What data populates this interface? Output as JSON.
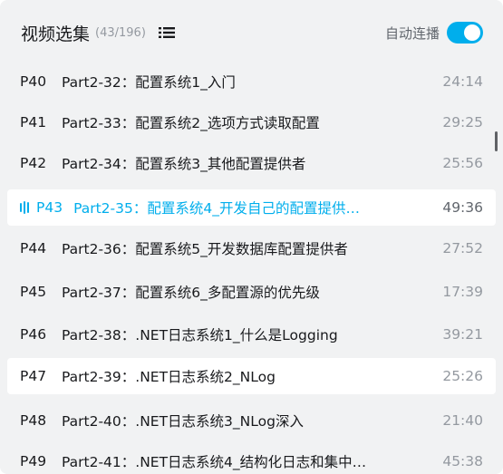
{
  "header": {
    "title": "视频选集",
    "count": "(43/196)",
    "list_icon": "list-icon",
    "autoplay_label": "自动连播",
    "autoplay_on": true
  },
  "episodes": [
    {
      "ep": "P40",
      "title": "Part2-32：配置系统1_入门",
      "duration": "24:14"
    },
    {
      "ep": "P41",
      "title": "Part2-33：配置系统2_选项方式读取配置",
      "duration": "29:25"
    },
    {
      "ep": "P42",
      "title": "Part2-34：配置系统3_其他配置提供者",
      "duration": "25:56"
    },
    {
      "ep": "P43",
      "title": "Part2-35：配置系统4_开发自己的配置提供…",
      "duration": "49:36"
    },
    {
      "ep": "P44",
      "title": "Part2-36：配置系统5_开发数据库配置提供者",
      "duration": "27:52"
    },
    {
      "ep": "P45",
      "title": "Part2-37：配置系统6_多配置源的优先级",
      "duration": "17:39"
    },
    {
      "ep": "P46",
      "title": "Part2-38：.NET日志系统1_什么是Logging",
      "duration": "39:21"
    },
    {
      "ep": "P47",
      "title": "Part2-39：.NET日志系统2_NLog",
      "duration": "25:26"
    },
    {
      "ep": "P48",
      "title": "Part2-40：.NET日志系统3_NLog深入",
      "duration": "21:40"
    },
    {
      "ep": "P49",
      "title": "Part2-41：.NET日志系统4_结构化日志和集中…",
      "duration": "45:38"
    }
  ],
  "colors": {
    "accent": "#00aeec",
    "panel_bg": "#f1f2f3",
    "text": "#18191c",
    "muted": "#9499a0"
  }
}
